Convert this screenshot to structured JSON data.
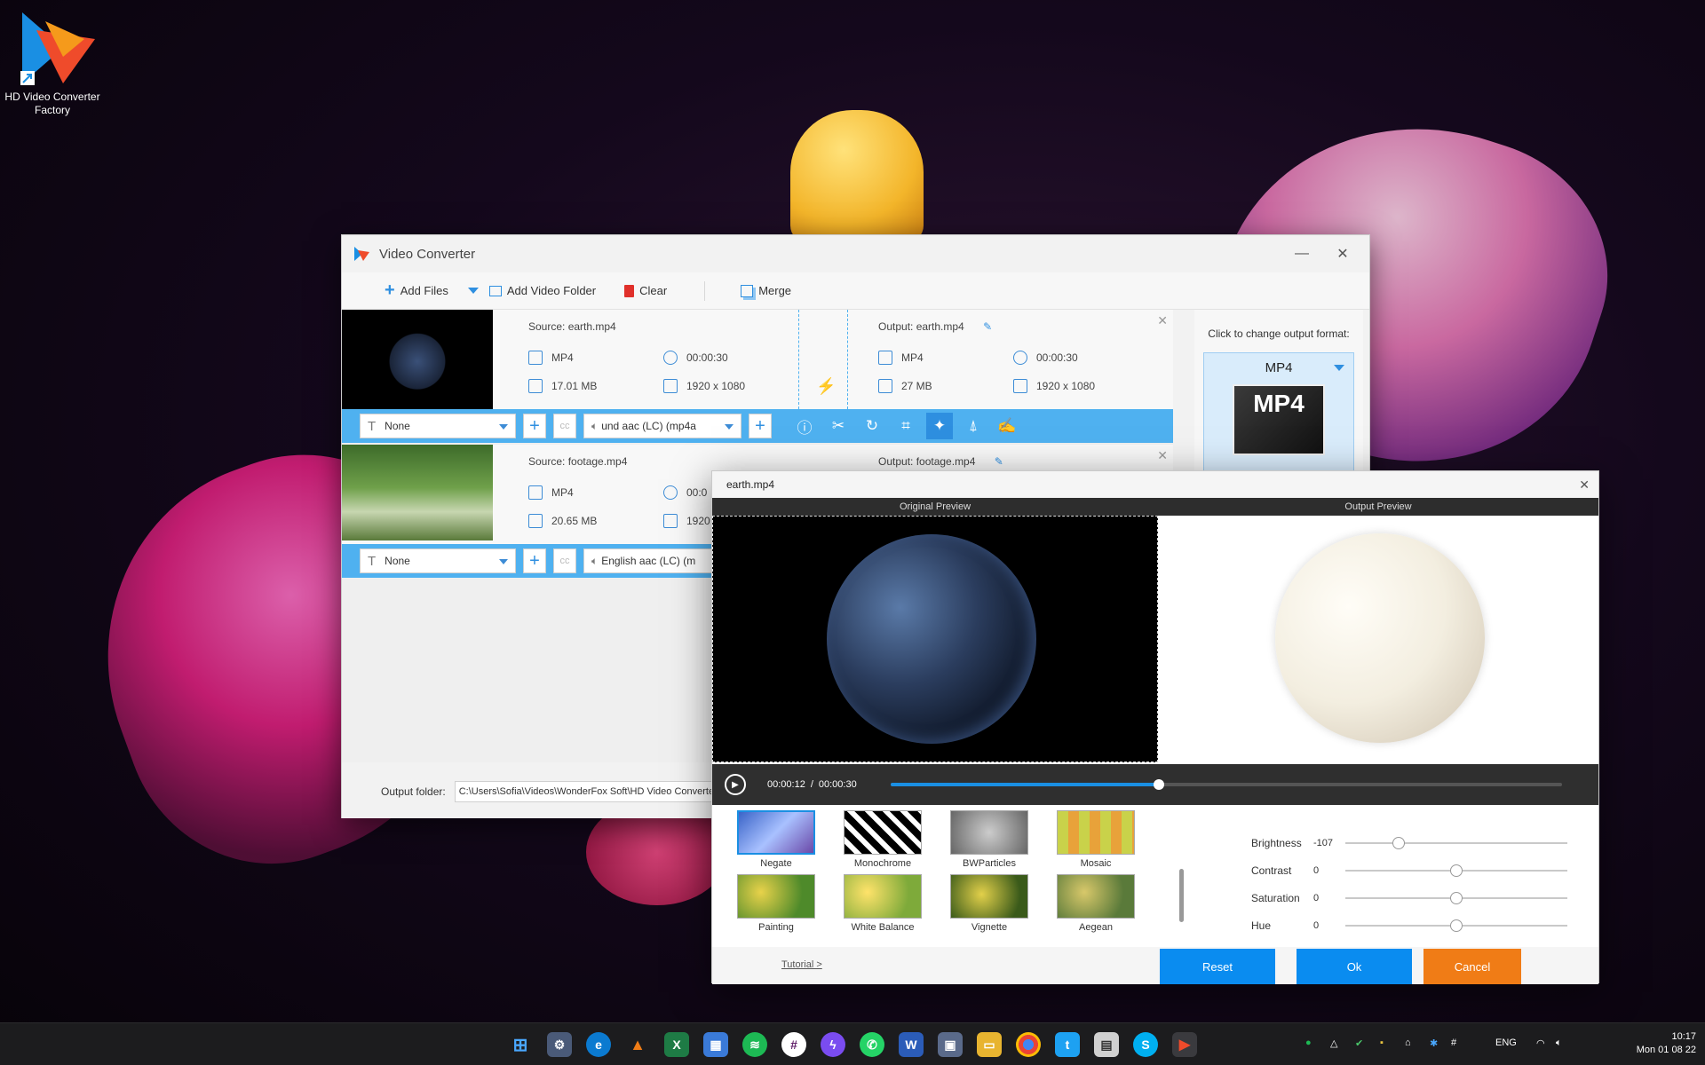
{
  "desktop": {
    "icon_label": "HD Video Converter Factory"
  },
  "window": {
    "title": "Video Converter",
    "minimize": "—",
    "close": "✕"
  },
  "toolbar": {
    "add_files": "Add Files",
    "add_folder": "Add Video Folder",
    "clear": "Clear",
    "merge": "Merge"
  },
  "items": [
    {
      "source": "Source: earth.mp4",
      "format": "MP4",
      "duration": "00:00:30",
      "size": "17.01 MB",
      "resolution": "1920 x 1080",
      "output": "Output: earth.mp4",
      "out_format": "MP4",
      "out_duration": "00:00:30",
      "out_size": "27 MB",
      "out_resolution": "1920 x 1080",
      "subtitle": "None",
      "audio": "und aac (LC) (mp4a"
    },
    {
      "source": "Source: footage.mp4",
      "format": "MP4",
      "duration": "00:0",
      "size": "20.65 MB",
      "resolution": "1920",
      "output": "Output: footage.mp4",
      "subtitle": "None",
      "audio": "English aac (LC) (m"
    }
  ],
  "output_folder": {
    "label": "Output folder:",
    "path": "C:\\Users\\Sofia\\Videos\\WonderFox Soft\\HD Video Converter"
  },
  "format_panel": {
    "hint": "Click to change output format:",
    "selected": "MP4",
    "badge": "MP4"
  },
  "dialog": {
    "title": "earth.mp4",
    "original_preview": "Original Preview",
    "output_preview": "Output Preview",
    "time_current": "00:00:12",
    "time_sep": "/",
    "time_total": "00:00:30",
    "progress": 0.4,
    "effects": [
      "Negate",
      "Monochrome",
      "BWParticles",
      "Mosaic",
      "Painting",
      "White Balance",
      "Vignette",
      "Aegean"
    ],
    "adjust": [
      {
        "label": "Brightness",
        "value": "-107",
        "pos": 0.24
      },
      {
        "label": "Contrast",
        "value": "0",
        "pos": 0.5
      },
      {
        "label": "Saturation",
        "value": "0",
        "pos": 0.5
      },
      {
        "label": "Hue",
        "value": "0",
        "pos": 0.5
      }
    ],
    "tutorial": "Tutorial >",
    "reset": "Reset",
    "ok": "Ok",
    "cancel": "Cancel"
  },
  "taskbar": {
    "lang": "ENG",
    "time": "10:17",
    "date": "Mon 01 08 22"
  },
  "colors": {
    "accent": "#4fb1f0",
    "button_blue": "#0a8cf0",
    "cancel_orange": "#f07c16"
  }
}
